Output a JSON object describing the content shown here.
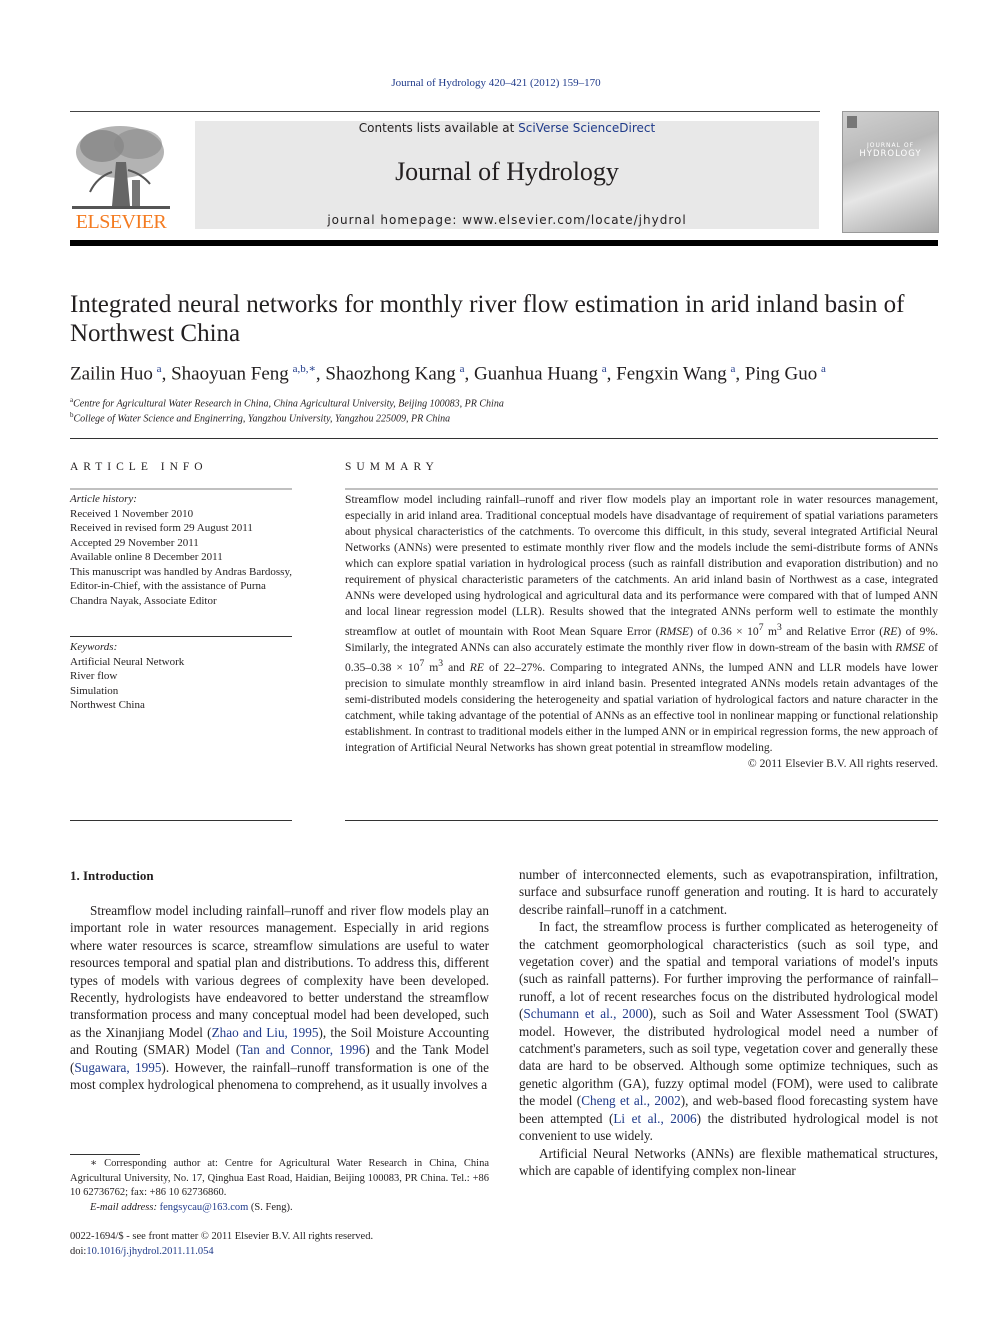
{
  "header": {
    "journal_ref": "Journal of Hydrology 420–421 (2012) 159–170",
    "publisher_logo_text": "ELSEVIER",
    "contents_prefix": "Contents lists available at ",
    "contents_link": "SciVerse ScienceDirect",
    "journal_name": "Journal of Hydrology",
    "homepage": "journal homepage: www.elsevier.com/locate/jhydrol",
    "cover_title_line1": "JOURNAL OF",
    "cover_title_line2": "HYDROLOGY",
    "colors": {
      "link": "#1f3a8a",
      "elsevier_orange": "#f47b20",
      "banner_bg": "#e8e8e8"
    }
  },
  "article": {
    "title": "Integrated neural networks for monthly river flow estimation in arid inland basin of Northwest China",
    "authors": [
      {
        "name": "Zailin Huo",
        "sup": "a"
      },
      {
        "name": "Shaoyuan Feng",
        "sup": "a,b,∗"
      },
      {
        "name": "Shaozhong Kang",
        "sup": "a"
      },
      {
        "name": "Guanhua Huang",
        "sup": "a"
      },
      {
        "name": "Fengxin Wang",
        "sup": "a"
      },
      {
        "name": "Ping Guo",
        "sup": "a"
      }
    ],
    "affiliations": [
      {
        "key": "a",
        "text": "Centre for Agricultural Water Research in China, China Agricultural University, Beijing 100083, PR China"
      },
      {
        "key": "b",
        "text": "College of Water Science and Enginerring, Yangzhou University, Yangzhou 225009, PR China"
      }
    ]
  },
  "article_info": {
    "heading": "ARTICLE INFO",
    "history_label": "Article history:",
    "history": [
      "Received 1 November 2010",
      "Received in revised form 29 August 2011",
      "Accepted 29 November 2011",
      "Available online 8 December 2011",
      "This manuscript was handled by Andras Bardossy, Editor-in-Chief, with the assistance of Purna Chandra Nayak, Associate Editor"
    ],
    "keywords_label": "Keywords:",
    "keywords": [
      "Artificial Neural Network",
      "River flow",
      "Simulation",
      "Northwest China"
    ]
  },
  "summary": {
    "heading": "SUMMARY",
    "text_1": "Streamflow model including rainfall–runoff and river flow models play an important role in water resources management, especially in arid inland area. Traditional conceptual models have disadvantage of requirement of spatial variations parameters about physical characteristics of the catchments. To overcome this difficult, in this study, several integrated Artificial Neural Networks (ANNs) were presented to estimate monthly river flow and the models include the semi-distribute forms of ANNs which can explore spatial variation in hydrological process (such as rainfall distribution and evaporation distribution) and no requirement of physical characteristic parameters of the catchments. An arid inland basin of Northwest as a case, integrated ANNs were developed using hydrological and agricultural data and its performance were compared with that of lumped ANN and local linear regression model (LLR). Results showed that the integrated ANNs perform well to estimate the monthly streamflow at outlet of mountain with Root Mean Square Error (",
    "rmse": "RMSE",
    "text_2": ") of 0.36 × 10",
    "exp": "7",
    "unit": " m",
    "cube": "3",
    "text_3": " and Relative Error (",
    "re": "RE",
    "text_4": ") of 9%. Similarly, the integrated ANNs can also accurately estimate the monthly river flow in down-stream of the basin with ",
    "text_5": " of 0.35–0.38 × 10",
    "text_6": " and ",
    "text_7": " of 22–27%. Comparing to integrated ANNs, the lumped ANN and LLR models have lower precision to simulate monthly streamflow in aird inland basin. Presented integrated ANNs models retain advantages of the semi-distributed models considering the heterogeneity and spatial variation of hydrological factors and nature character in the catchment, while taking advantage of the potential of ANNs as an effective tool in nonlinear mapping or functional relationship establishment. In contrast to traditional models either in the lumped ANN or in empirical regression forms, the new approach of integration of Artificial Neural Networks has shown great potential in streamflow modeling.",
    "copyright": "© 2011 Elsevier B.V. All rights reserved."
  },
  "introduction": {
    "heading": "1. Introduction",
    "p1_a": "Streamflow model including rainfall–runoff and river flow models play an important role in water resources management. Especially in arid regions where water resources is scarce, streamflow simulations are useful to water resources temporal and spatial plan and distributions. To address this, different types of models with various degrees of complexity have been developed. Recently, hydrologists have endeavored to better understand the streamflow transformation process and many conceptual model had been developed, such as the Xinanjiang Model (",
    "ref_zhao": "Zhao and Liu, 1995",
    "p1_b": "), the Soil Moisture Accounting and Routing (SMAR) Model (",
    "ref_tan": "Tan and Connor, 1996",
    "p1_c": ") and the Tank Model (",
    "ref_sugawara": "Sugawara, 1995",
    "p1_d": "). However, the rainfall–runoff transformation is one of the most complex hydrological phenomena to comprehend, as it usually involves a number of interconnected elements, such as evapotranspiration, infiltration, surface and subsurface runoff generation and routing. It is hard to accurately describe rainfall–runoff in a catchment.",
    "p1_left": "Streamflow model including rainfall–runoff and river flow models play an important role in water resources management. Especially in arid regions where water resources is scarce, streamflow simulations are useful to water resources temporal and spatial plan and distributions. To address this, different types of models with various degrees of complexity have been developed. Recently, hydrologists have endeavored to better understand the streamflow transformation process and many conceptual model had been developed, such as the Xinanjiang Model (",
    "p1_left_end": "). However, the rainfall–runoff transformation is one of the most complex hydrological phenomena to comprehend, as it usually involves a",
    "p1_right_cont": "number of interconnected elements, such as evapotranspiration, infiltration, surface and subsurface runoff generation and routing. It is hard to accurately describe rainfall–runoff in a catchment.",
    "p2_a": "In fact, the streamflow process is further complicated as heterogeneity of the catchment geomorphological characteristics (such as soil type, and vegetation cover) and the spatial and temporal variations of model's inputs (such as rainfall patterns). For further improving the performance of rainfall–runoff, a lot of recent researches focus on the distributed hydrological model (",
    "ref_schumann": "Schumann et al., 2000",
    "p2_b": "), such as Soil and Water Assessment Tool (SWAT) model. However, the distributed hydrological model need a number of catchment's parameters, such as soil type, vegetation cover and generally these data are hard to be observed. Although some optimize techniques, such as genetic algorithm (GA), fuzzy optimal model (FOM), were used to calibrate the model (",
    "ref_cheng": "Cheng et al., 2002",
    "p2_c": "), and web-based flood forecasting system have been attempted (",
    "ref_li": "Li et al., 2006",
    "p2_d": ") the distributed hydrological model is not convenient to use widely.",
    "p3": "Artificial Neural Networks (ANNs) are flexible mathematical structures, which are capable of identifying complex non-linear"
  },
  "footnote": {
    "corresponding": "∗ Corresponding author at: Centre for Agricultural Water Research in China, China Agricultural University, No. 17, Qinghua East Road, Haidian, Beijing 100083, PR China. Tel.: +86 10 62736762; fax: +86 10 62736860.",
    "email_label": "E-mail address:",
    "email": "fengsycau@163.com",
    "email_suffix": " (S. Feng).",
    "front_matter": "0022-1694/$ - see front matter © 2011 Elsevier B.V. All rights reserved.",
    "doi_label": "doi:",
    "doi": "10.1016/j.jhydrol.2011.11.054"
  }
}
